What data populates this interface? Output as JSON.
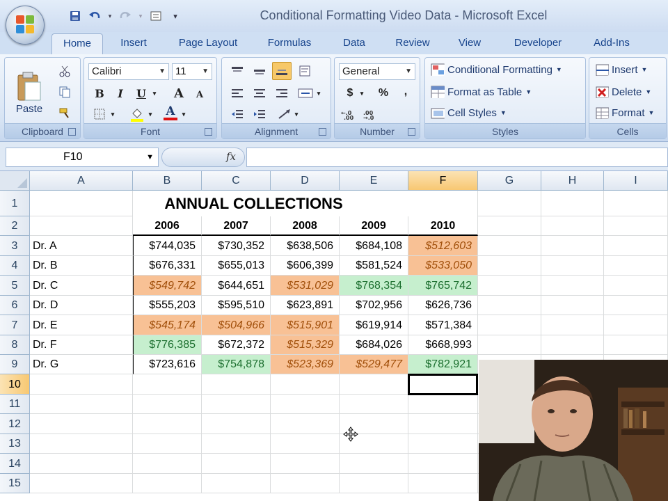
{
  "window": {
    "title": "Conditional Formatting Video Data - Microsoft Excel"
  },
  "tabs": [
    "Home",
    "Insert",
    "Page Layout",
    "Formulas",
    "Data",
    "Review",
    "View",
    "Developer",
    "Add-Ins"
  ],
  "ribbon": {
    "clipboard": {
      "label": "Clipboard",
      "paste": "Paste"
    },
    "font": {
      "label": "Font",
      "family": "Calibri",
      "size": "11",
      "bold": "B",
      "italic": "I",
      "underline": "U",
      "grow": "A",
      "shrink": "A",
      "color_letter": "A"
    },
    "alignment": {
      "label": "Alignment"
    },
    "number": {
      "label": "Number",
      "format": "General",
      "currency": "$",
      "percent": "%",
      "comma": ","
    },
    "styles": {
      "label": "Styles",
      "conditional": "Conditional Formatting",
      "format_table": "Format as Table",
      "cell_styles": "Cell Styles"
    },
    "cells": {
      "label": "Cells",
      "insert": "Insert",
      "delete": "Delete",
      "format": "Format"
    }
  },
  "formula_bar": {
    "name_box": "F10",
    "fx": "fx",
    "content": ""
  },
  "sheet": {
    "columns": [
      "A",
      "B",
      "C",
      "D",
      "E",
      "F",
      "G",
      "H",
      "I"
    ],
    "selected_column": "F",
    "rows": [
      "1",
      "2",
      "3",
      "4",
      "5",
      "6",
      "7",
      "8",
      "9",
      "10",
      "11",
      "12",
      "13",
      "14",
      "15"
    ],
    "selected_row": "10",
    "title": "ANNUAL COLLECTIONS",
    "years": [
      "2006",
      "2007",
      "2008",
      "2009",
      "2010"
    ],
    "data": [
      {
        "name": "Dr. A",
        "values": [
          "$744,035",
          "$730,352",
          "$638,506",
          "$684,108",
          "$512,603"
        ],
        "fmt": [
          "",
          "",
          "",
          "",
          "orange"
        ]
      },
      {
        "name": "Dr. B",
        "values": [
          "$676,331",
          "$655,013",
          "$606,399",
          "$581,524",
          "$533,050"
        ],
        "fmt": [
          "",
          "",
          "",
          "",
          "orange"
        ]
      },
      {
        "name": "Dr. C",
        "values": [
          "$549,742",
          "$644,651",
          "$531,029",
          "$768,354",
          "$765,742"
        ],
        "fmt": [
          "orange",
          "",
          "orange",
          "green",
          "green"
        ]
      },
      {
        "name": "Dr. D",
        "values": [
          "$555,203",
          "$595,510",
          "$623,891",
          "$702,956",
          "$626,736"
        ],
        "fmt": [
          "",
          "",
          "",
          "",
          ""
        ]
      },
      {
        "name": "Dr. E",
        "values": [
          "$545,174",
          "$504,966",
          "$515,901",
          "$619,914",
          "$571,384"
        ],
        "fmt": [
          "orange",
          "orange",
          "orange",
          "",
          ""
        ]
      },
      {
        "name": "Dr. F",
        "values": [
          "$776,385",
          "$672,372",
          "$515,329",
          "$684,026",
          "$668,993"
        ],
        "fmt": [
          "green",
          "",
          "orange",
          "",
          ""
        ]
      },
      {
        "name": "Dr. G",
        "values": [
          "$723,616",
          "$754,878",
          "$523,369",
          "$529,477",
          "$782,921"
        ],
        "fmt": [
          "",
          "green",
          "orange",
          "orange",
          "green"
        ]
      }
    ]
  },
  "colors": {
    "orange_fill": "#f8c195",
    "orange_text": "#a14f0a",
    "green_fill": "#c6efce",
    "green_text": "#1b6e2e",
    "accent": "#15428b"
  }
}
